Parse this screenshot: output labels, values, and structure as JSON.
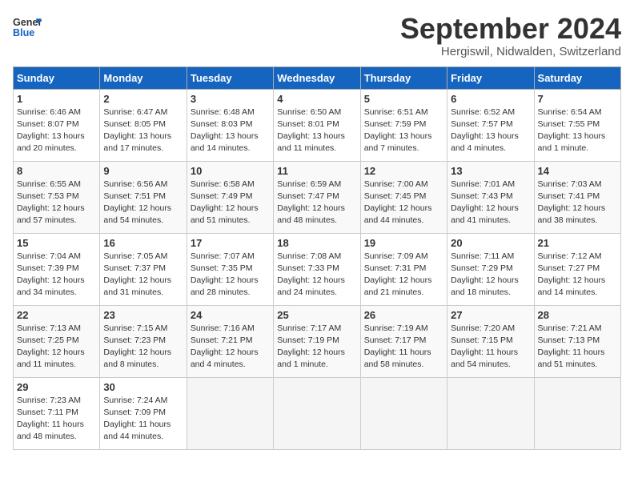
{
  "header": {
    "logo_line1": "General",
    "logo_line2": "Blue",
    "month": "September 2024",
    "location": "Hergiswil, Nidwalden, Switzerland"
  },
  "weekdays": [
    "Sunday",
    "Monday",
    "Tuesday",
    "Wednesday",
    "Thursday",
    "Friday",
    "Saturday"
  ],
  "weeks": [
    [
      {
        "day": "1",
        "info": "Sunrise: 6:46 AM\nSunset: 8:07 PM\nDaylight: 13 hours\nand 20 minutes."
      },
      {
        "day": "2",
        "info": "Sunrise: 6:47 AM\nSunset: 8:05 PM\nDaylight: 13 hours\nand 17 minutes."
      },
      {
        "day": "3",
        "info": "Sunrise: 6:48 AM\nSunset: 8:03 PM\nDaylight: 13 hours\nand 14 minutes."
      },
      {
        "day": "4",
        "info": "Sunrise: 6:50 AM\nSunset: 8:01 PM\nDaylight: 13 hours\nand 11 minutes."
      },
      {
        "day": "5",
        "info": "Sunrise: 6:51 AM\nSunset: 7:59 PM\nDaylight: 13 hours\nand 7 minutes."
      },
      {
        "day": "6",
        "info": "Sunrise: 6:52 AM\nSunset: 7:57 PM\nDaylight: 13 hours\nand 4 minutes."
      },
      {
        "day": "7",
        "info": "Sunrise: 6:54 AM\nSunset: 7:55 PM\nDaylight: 13 hours\nand 1 minute."
      }
    ],
    [
      {
        "day": "8",
        "info": "Sunrise: 6:55 AM\nSunset: 7:53 PM\nDaylight: 12 hours\nand 57 minutes."
      },
      {
        "day": "9",
        "info": "Sunrise: 6:56 AM\nSunset: 7:51 PM\nDaylight: 12 hours\nand 54 minutes."
      },
      {
        "day": "10",
        "info": "Sunrise: 6:58 AM\nSunset: 7:49 PM\nDaylight: 12 hours\nand 51 minutes."
      },
      {
        "day": "11",
        "info": "Sunrise: 6:59 AM\nSunset: 7:47 PM\nDaylight: 12 hours\nand 48 minutes."
      },
      {
        "day": "12",
        "info": "Sunrise: 7:00 AM\nSunset: 7:45 PM\nDaylight: 12 hours\nand 44 minutes."
      },
      {
        "day": "13",
        "info": "Sunrise: 7:01 AM\nSunset: 7:43 PM\nDaylight: 12 hours\nand 41 minutes."
      },
      {
        "day": "14",
        "info": "Sunrise: 7:03 AM\nSunset: 7:41 PM\nDaylight: 12 hours\nand 38 minutes."
      }
    ],
    [
      {
        "day": "15",
        "info": "Sunrise: 7:04 AM\nSunset: 7:39 PM\nDaylight: 12 hours\nand 34 minutes."
      },
      {
        "day": "16",
        "info": "Sunrise: 7:05 AM\nSunset: 7:37 PM\nDaylight: 12 hours\nand 31 minutes."
      },
      {
        "day": "17",
        "info": "Sunrise: 7:07 AM\nSunset: 7:35 PM\nDaylight: 12 hours\nand 28 minutes."
      },
      {
        "day": "18",
        "info": "Sunrise: 7:08 AM\nSunset: 7:33 PM\nDaylight: 12 hours\nand 24 minutes."
      },
      {
        "day": "19",
        "info": "Sunrise: 7:09 AM\nSunset: 7:31 PM\nDaylight: 12 hours\nand 21 minutes."
      },
      {
        "day": "20",
        "info": "Sunrise: 7:11 AM\nSunset: 7:29 PM\nDaylight: 12 hours\nand 18 minutes."
      },
      {
        "day": "21",
        "info": "Sunrise: 7:12 AM\nSunset: 7:27 PM\nDaylight: 12 hours\nand 14 minutes."
      }
    ],
    [
      {
        "day": "22",
        "info": "Sunrise: 7:13 AM\nSunset: 7:25 PM\nDaylight: 12 hours\nand 11 minutes."
      },
      {
        "day": "23",
        "info": "Sunrise: 7:15 AM\nSunset: 7:23 PM\nDaylight: 12 hours\nand 8 minutes."
      },
      {
        "day": "24",
        "info": "Sunrise: 7:16 AM\nSunset: 7:21 PM\nDaylight: 12 hours\nand 4 minutes."
      },
      {
        "day": "25",
        "info": "Sunrise: 7:17 AM\nSunset: 7:19 PM\nDaylight: 12 hours\nand 1 minute."
      },
      {
        "day": "26",
        "info": "Sunrise: 7:19 AM\nSunset: 7:17 PM\nDaylight: 11 hours\nand 58 minutes."
      },
      {
        "day": "27",
        "info": "Sunrise: 7:20 AM\nSunset: 7:15 PM\nDaylight: 11 hours\nand 54 minutes."
      },
      {
        "day": "28",
        "info": "Sunrise: 7:21 AM\nSunset: 7:13 PM\nDaylight: 11 hours\nand 51 minutes."
      }
    ],
    [
      {
        "day": "29",
        "info": "Sunrise: 7:23 AM\nSunset: 7:11 PM\nDaylight: 11 hours\nand 48 minutes."
      },
      {
        "day": "30",
        "info": "Sunrise: 7:24 AM\nSunset: 7:09 PM\nDaylight: 11 hours\nand 44 minutes."
      },
      null,
      null,
      null,
      null,
      null
    ]
  ]
}
